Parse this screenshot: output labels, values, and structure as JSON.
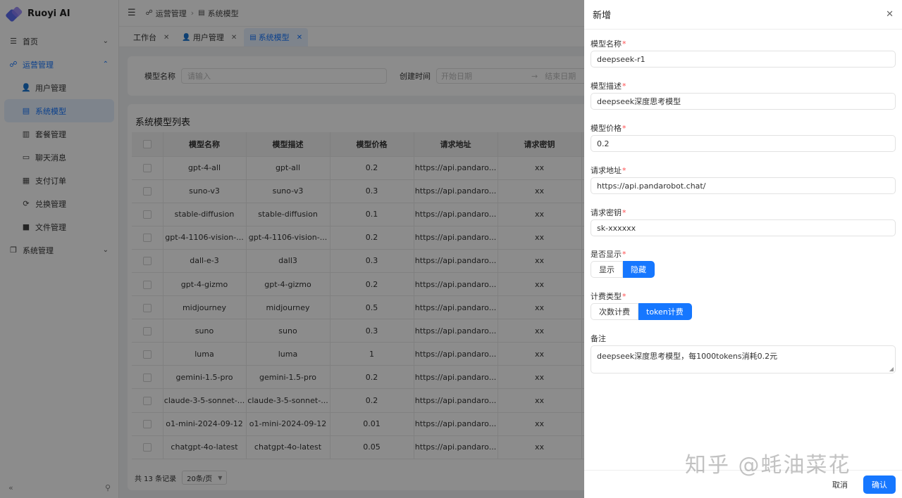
{
  "app": {
    "name": "Ruoyi AI"
  },
  "sidebar": {
    "items": [
      {
        "label": "首页",
        "icon": "menu-lines-icon"
      },
      {
        "label": "运营管理",
        "icon": "operations-icon"
      },
      {
        "label": "用户管理",
        "icon": "user-icon"
      },
      {
        "label": "系统模型",
        "icon": "list-icon"
      },
      {
        "label": "套餐管理",
        "icon": "package-icon"
      },
      {
        "label": "聊天消息",
        "icon": "chat-icon"
      },
      {
        "label": "支付订单",
        "icon": "order-icon"
      },
      {
        "label": "兑换管理",
        "icon": "exchange-icon"
      },
      {
        "label": "文件管理",
        "icon": "folder-icon"
      },
      {
        "label": "系统管理",
        "icon": "system-icon"
      }
    ],
    "footer": {
      "collapse": "«",
      "pin": "pin-icon"
    }
  },
  "header": {
    "breadcrumb": [
      "运营管理",
      "系统模型"
    ]
  },
  "tabs": [
    {
      "label": "工作台"
    },
    {
      "label": "用户管理"
    },
    {
      "label": "系统模型"
    }
  ],
  "search": {
    "name_label": "模型名称",
    "name_placeholder": "请输入",
    "date_label": "创建时间",
    "date_start": "开始日期",
    "date_end": "结束日期"
  },
  "table": {
    "title": "系统模型列表",
    "columns": [
      "模型名称",
      "模型描述",
      "模型价格",
      "请求地址",
      "请求密钥"
    ],
    "rows": [
      [
        "gpt-4-all",
        "gpt-all",
        "0.2",
        "https://api.pandaro...",
        "xx"
      ],
      [
        "suno-v3",
        "suno-v3",
        "0.3",
        "https://api.pandaro...",
        "xx"
      ],
      [
        "stable-diffusion",
        "stable-diffusion",
        "0.1",
        "https://api.pandaro...",
        "xx"
      ],
      [
        "gpt-4-1106-vision-...",
        "gpt-4-1106-vision-...",
        "0.2",
        "https://api.pandaro...",
        "xx"
      ],
      [
        "dall-e-3",
        "dall3",
        "0.3",
        "https://api.pandaro...",
        "xx"
      ],
      [
        "gpt-4-gizmo",
        "gpt-4-gizmo",
        "0.2",
        "https://api.pandaro...",
        "xx"
      ],
      [
        "midjourney",
        "midjourney",
        "0.5",
        "https://api.pandaro...",
        "xx"
      ],
      [
        "suno",
        "suno",
        "0.3",
        "https://api.pandaro...",
        "xx"
      ],
      [
        "luma",
        "luma",
        "1",
        "https://api.pandaro...",
        "xx"
      ],
      [
        "gemini-1.5-pro",
        "gemini-1.5-pro",
        "0.2",
        "https://api.pandaro...",
        "xx"
      ],
      [
        "claude-3-5-sonnet-...",
        "claude-3-5-sonnet-...",
        "0.2",
        "https://api.pandaro...",
        "xx"
      ],
      [
        "o1-mini-2024-09-12",
        "o1-mini-2024-09-12",
        "0.01",
        "https://api.pandaro...",
        "xx"
      ],
      [
        "chatgpt-4o-latest",
        "chatgpt-4o-latest",
        "0.05",
        "https://api.pandaro...",
        "xx"
      ]
    ],
    "total_text": "共 13 条记录",
    "page_size": "20条/页"
  },
  "drawer": {
    "title": "新增",
    "fields": {
      "name": {
        "label": "模型名称",
        "value": "deepseek-r1"
      },
      "desc": {
        "label": "模型描述",
        "value": "deepseek深度思考模型"
      },
      "price": {
        "label": "模型价格",
        "value": "0.2"
      },
      "url": {
        "label": "请求地址",
        "value": "https://api.pandarobot.chat/"
      },
      "key": {
        "label": "请求密钥",
        "value": "sk-xxxxxx"
      },
      "show": {
        "label": "是否显示",
        "options": [
          "显示",
          "隐藏"
        ],
        "selected": "隐藏"
      },
      "billing": {
        "label": "计费类型",
        "options": [
          "次数计费",
          "token计费"
        ],
        "selected": "token计费"
      },
      "remark": {
        "label": "备注",
        "value": "deepseek深度思考模型，每1000tokens消耗0.2元"
      }
    },
    "required_mark": "*",
    "cancel": "取消",
    "confirm": "确认"
  },
  "watermark": "知乎 @蚝油菜花",
  "colors": {
    "primary": "#1677ff",
    "required": "#ff4d4f"
  }
}
